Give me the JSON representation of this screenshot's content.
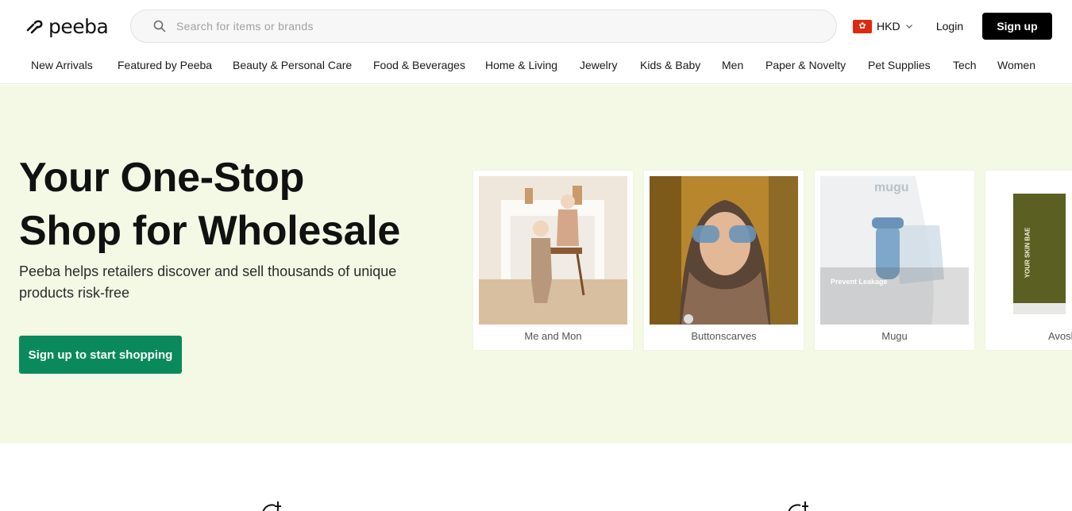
{
  "brand": {
    "name": "peeba"
  },
  "search": {
    "placeholder": "Search for items or brands",
    "value": ""
  },
  "currency": {
    "code": "HKD",
    "flag": "hong-kong-flag",
    "flag_color": "#de2910"
  },
  "auth": {
    "login_label": "Login",
    "signup_label": "Sign up"
  },
  "nav": {
    "items": [
      "New Arrivals",
      "Featured by Peeba",
      "Beauty & Personal Care",
      "Food & Beverages",
      "Home & Living",
      "Jewelry",
      "Kids & Baby",
      "Men",
      "Paper & Novelty",
      "Pet Supplies",
      "Tech",
      "Women"
    ]
  },
  "hero": {
    "title_line1": "Your One-Stop",
    "title_line2": "Shop for Wholesale",
    "subtitle": "Peeba helps retailers discover and sell thousands of unique products risk-free",
    "cta_label": "Sign up to start shopping",
    "background": "#f4f9e6",
    "cta_color": "#0a8a5c"
  },
  "brands": [
    {
      "name": "Me and Mon"
    },
    {
      "name": "Buttonscarves"
    },
    {
      "name": "Mugu",
      "image_text": {
        "logo": "mugu",
        "headline": "Prevent Leakage"
      }
    },
    {
      "name": "Avoskin",
      "visible_name": "Avosl",
      "image_text": {
        "package": "YOUR SKIN BAE"
      }
    }
  ]
}
